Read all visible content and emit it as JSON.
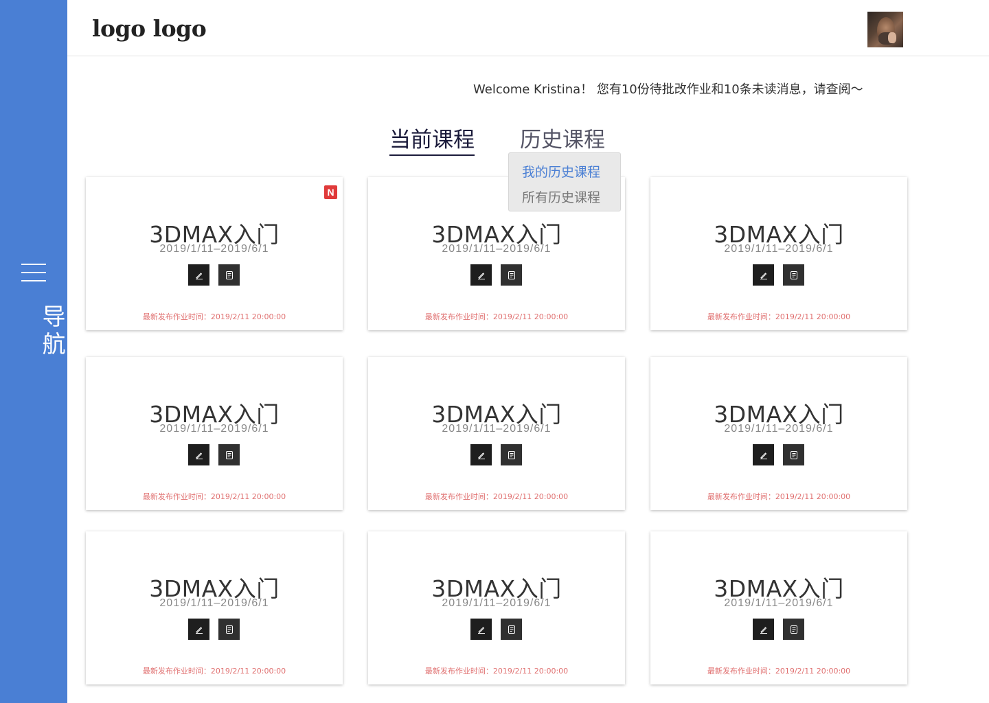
{
  "sidebar": {
    "menu_icon": "hamburger-icon",
    "label": "导航",
    "color": "#4a7fd4"
  },
  "header": {
    "logo": "logo logo",
    "avatar": "user-avatar"
  },
  "welcome": "Welcome Kristina！ 您有10份待批改作业和10条未读消息，请查阅～",
  "tabs": {
    "current": "当前课程",
    "history": "历史课程"
  },
  "history_dropdown": {
    "items": [
      "我的历史课程",
      "所有历史课程"
    ]
  },
  "courses": [
    {
      "title": "3DMAX入门",
      "dates": "2019/1/11–2019/6/1",
      "footer": "最新发布作业时间：2019/2/11 20:00:00",
      "badge": "N"
    },
    {
      "title": "3DMAX入门",
      "dates": "2019/1/11–2019/6/1",
      "footer": "最新发布作业时间：2019/2/11 20:00:00"
    },
    {
      "title": "3DMAX入门",
      "dates": "2019/1/11–2019/6/1",
      "footer": "最新发布作业时间：2019/2/11 20:00:00"
    },
    {
      "title": "3DMAX入门",
      "dates": "2019/1/11–2019/6/1",
      "footer": "最新发布作业时间：2019/2/11 20:00:00"
    },
    {
      "title": "3DMAX入门",
      "dates": "2019/1/11–2019/6/1",
      "footer": "最新发布作业时间：2019/2/11 20:00:00"
    },
    {
      "title": "3DMAX入门",
      "dates": "2019/1/11–2019/6/1",
      "footer": "最新发布作业时间：2019/2/11 20:00:00"
    },
    {
      "title": "3DMAX入门",
      "dates": "2019/1/11–2019/6/1",
      "footer": "最新发布作业时间：2019/2/11 20:00:00"
    },
    {
      "title": "3DMAX入门",
      "dates": "2019/1/11–2019/6/1",
      "footer": "最新发布作业时间：2019/2/11 20:00:00"
    },
    {
      "title": "3DMAX入门",
      "dates": "2019/1/11–2019/6/1",
      "footer": "最新发布作业时间：2019/2/11 20:00:00"
    }
  ],
  "card_icons": [
    "edit-icon",
    "notes-icon"
  ]
}
